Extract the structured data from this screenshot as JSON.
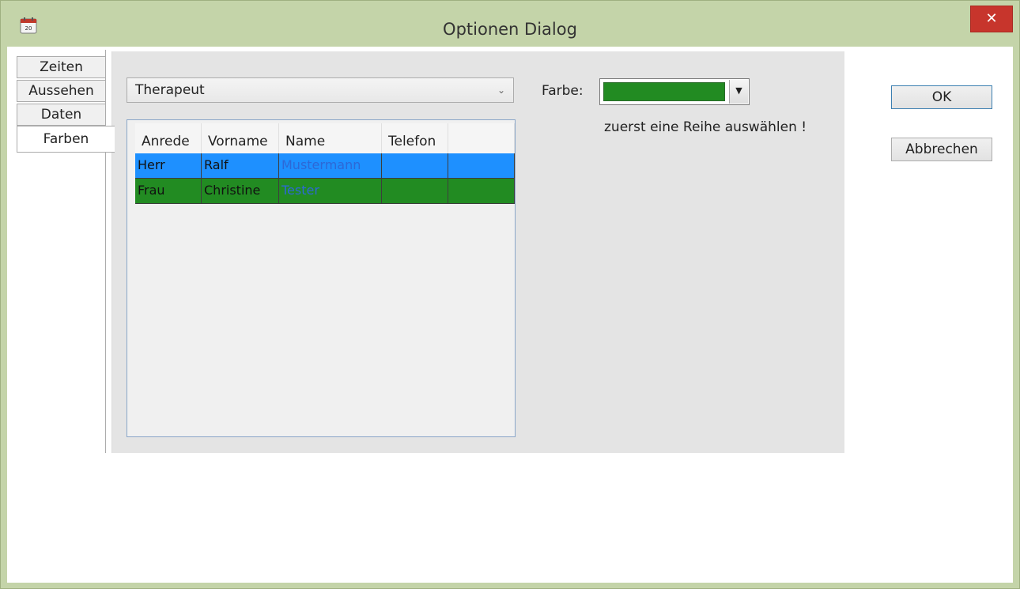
{
  "window": {
    "title": "Optionen Dialog",
    "close_icon": "close-x-icon",
    "app_icon": "calendar-icon",
    "calendar_day": "20"
  },
  "tabs": [
    {
      "label": "Zeiten",
      "active": false
    },
    {
      "label": "Aussehen",
      "active": false
    },
    {
      "label": "Daten",
      "active": false
    },
    {
      "label": "Farben",
      "active": true
    }
  ],
  "panel": {
    "category_select": {
      "value": "Therapeut"
    },
    "grid": {
      "columns": [
        "Anrede",
        "Vorname",
        "Name",
        "Telefon",
        ""
      ],
      "rows": [
        {
          "cells": [
            "Herr",
            "Ralf",
            "Mustermann",
            "",
            ""
          ],
          "background": "#1e90ff",
          "name_color": "#2d68d6"
        },
        {
          "cells": [
            "Frau",
            "Christine",
            "Tester",
            "",
            ""
          ],
          "background": "#228b22",
          "name_color": "#2d68d6"
        }
      ]
    },
    "color": {
      "label": "Farbe:",
      "value": "#228b22",
      "hint": "zuerst eine Reihe auswählen !"
    }
  },
  "buttons": {
    "ok": "OK",
    "cancel": "Abbrechen"
  }
}
